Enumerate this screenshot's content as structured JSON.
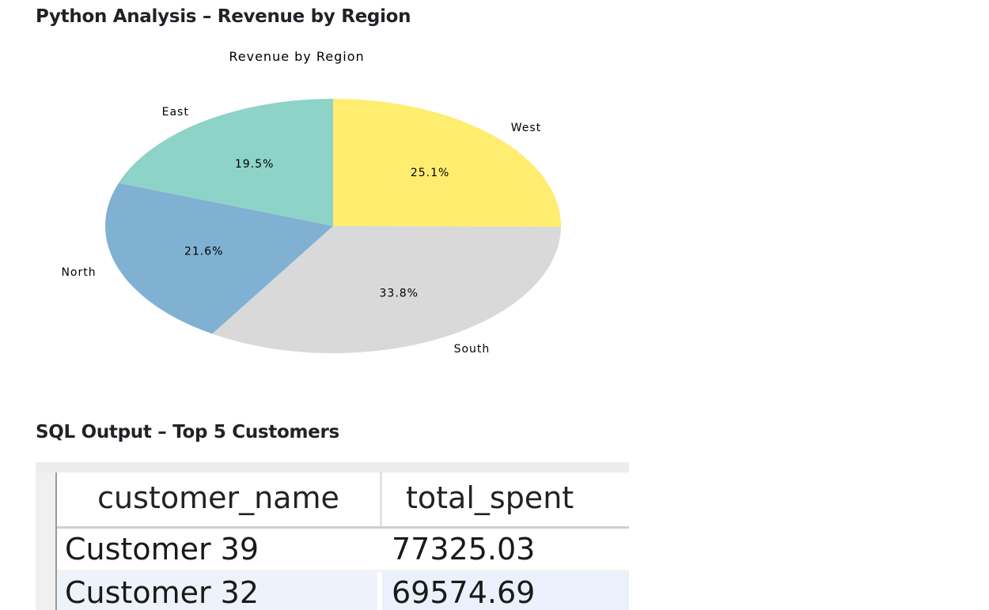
{
  "headings": {
    "python": "Python Analysis – Revenue by Region",
    "sql": "SQL Output – Top 5 Customers"
  },
  "chart_data": {
    "type": "pie",
    "title": "Revenue by Region",
    "slices": [
      {
        "label": "West",
        "value": 25.1,
        "pct_label": "25.1%",
        "color": "#ffed6f"
      },
      {
        "label": "South",
        "value": 33.8,
        "pct_label": "33.8%",
        "color": "#d9d9d9"
      },
      {
        "label": "North",
        "value": 21.6,
        "pct_label": "21.6%",
        "color": "#80b1d3"
      },
      {
        "label": "East",
        "value": 19.5,
        "pct_label": "19.5%",
        "color": "#8dd3c7"
      }
    ],
    "start_angle_deg": 90,
    "direction": "clockwise"
  },
  "sql_table": {
    "columns": [
      "customer_name",
      "total_spent"
    ],
    "rows": [
      [
        "Customer 39",
        "77325.03"
      ],
      [
        "Customer 32",
        "69574.69"
      ]
    ]
  }
}
